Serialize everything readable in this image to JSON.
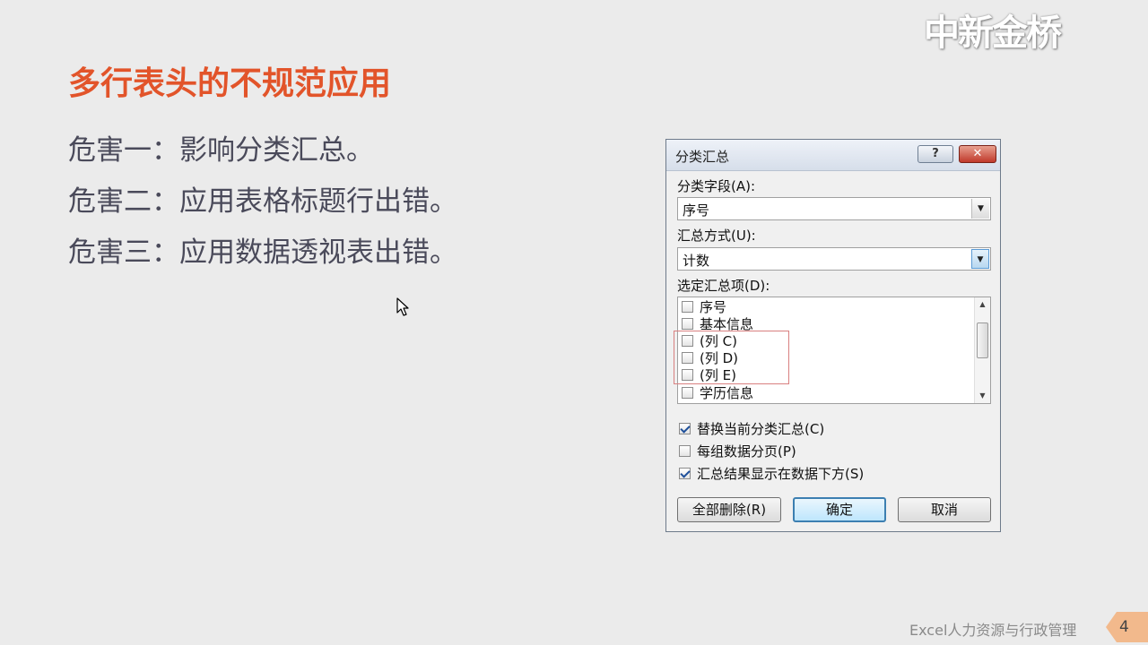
{
  "watermark": "中新金桥",
  "slide": {
    "title": "多行表头的不规范应用",
    "bullets": [
      "危害一：影响分类汇总。",
      "危害二：应用表格标题行出错。",
      "危害三：应用数据透视表出错。"
    ]
  },
  "dialog": {
    "title": "分类汇总",
    "help_label": "?",
    "close_label": "✕",
    "group_field_label": "分类字段(A):",
    "group_field_value": "序号",
    "function_label": "汇总方式(U):",
    "function_value": "计数",
    "add_to_label": "选定汇总项(D):",
    "items": [
      {
        "label": "序号",
        "checked": false
      },
      {
        "label": "基本信息",
        "checked": false
      },
      {
        "label": "(列 C)",
        "checked": false
      },
      {
        "label": "(列 D)",
        "checked": false
      },
      {
        "label": "(列 E)",
        "checked": false
      },
      {
        "label": "学历信息",
        "checked": false
      }
    ],
    "options": [
      {
        "label": "替换当前分类汇总(C)",
        "checked": true
      },
      {
        "label": "每组数据分页(P)",
        "checked": false
      },
      {
        "label": "汇总结果显示在数据下方(S)",
        "checked": true
      }
    ],
    "buttons": {
      "remove_all": "全部删除(R)",
      "ok": "确定",
      "cancel": "取消"
    }
  },
  "footer": {
    "text": "Excel人力资源与行政管理",
    "page_number": "4"
  },
  "colors": {
    "title": "#e2542a",
    "body_text": "#4a4a5a",
    "highlight_box": "#d98080",
    "page_tag": "#f2b98c"
  },
  "icons": {
    "cursor": "mouse-pointer-icon",
    "scroll_up": "triangle-up",
    "scroll_down": "triangle-down",
    "dropdown": "triangle-down"
  }
}
